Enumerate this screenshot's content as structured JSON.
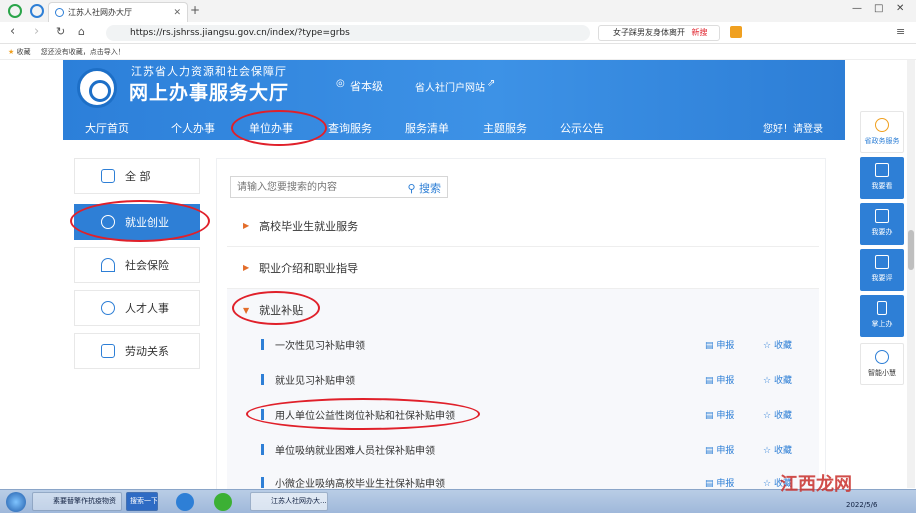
{
  "browser": {
    "tab_title": "江苏人社网办大厅",
    "url": "https://rs.jshrss.jiangsu.gov.cn/index/?type=grbs",
    "hot_search": "女子踩男友身体离开",
    "hot_tag": "新搜",
    "bookmarks_label": "收藏",
    "bookmarks_hint": "您还没有收藏，点击导入！"
  },
  "header": {
    "org_name": "江苏省人力资源和社会保障厅",
    "site_title": "网上办事服务大厅",
    "region": "省本级",
    "portal_link": "省人社门户网站",
    "nav": [
      "大厅首页",
      "个人办事",
      "单位办事",
      "查询服务",
      "服务清单",
      "主题服务",
      "公示公告"
    ],
    "greeting": "您好！请登录"
  },
  "left_menu": [
    {
      "label": "全 部",
      "icon": "grid-icon"
    },
    {
      "label": "就业创业",
      "icon": "briefcase-icon"
    },
    {
      "label": "社会保险",
      "icon": "umbrella-icon"
    },
    {
      "label": "人才人事",
      "icon": "people-icon"
    },
    {
      "label": "劳动关系",
      "icon": "document-icon"
    }
  ],
  "search": {
    "placeholder": "请输入您要搜索的内容",
    "button": "搜索"
  },
  "categories": [
    {
      "label": "高校毕业生就业服务"
    },
    {
      "label": "职业介绍和职业指导"
    },
    {
      "label": "就业补贴"
    }
  ],
  "items": [
    {
      "label": "一次性见习补贴申领"
    },
    {
      "label": "就业见习补贴申领"
    },
    {
      "label": "用人单位公益性岗位补贴和社保补贴申领"
    },
    {
      "label": "单位吸纳就业困难人员社保补贴申领"
    },
    {
      "label": "小微企业吸纳高校毕业生社保补贴申领"
    }
  ],
  "actions": {
    "apply": "申报",
    "favorite": "收藏"
  },
  "sidebar": [
    {
      "label": "省政务服务"
    },
    {
      "label": "我要看"
    },
    {
      "label": "我要办"
    },
    {
      "label": "我要评"
    },
    {
      "label": "掌上办"
    },
    {
      "label": "智能小慧"
    }
  ],
  "taskbar": {
    "items": [
      "素要替擎作抗疫物资",
      "搜索一下",
      "江苏人社网办大..."
    ],
    "date": "2022/5/6"
  },
  "watermark": "江西龙网",
  "colors": {
    "accent": "#2e7fd6",
    "annotation": "#e0202a",
    "category_arrow": "#e36d2a"
  }
}
